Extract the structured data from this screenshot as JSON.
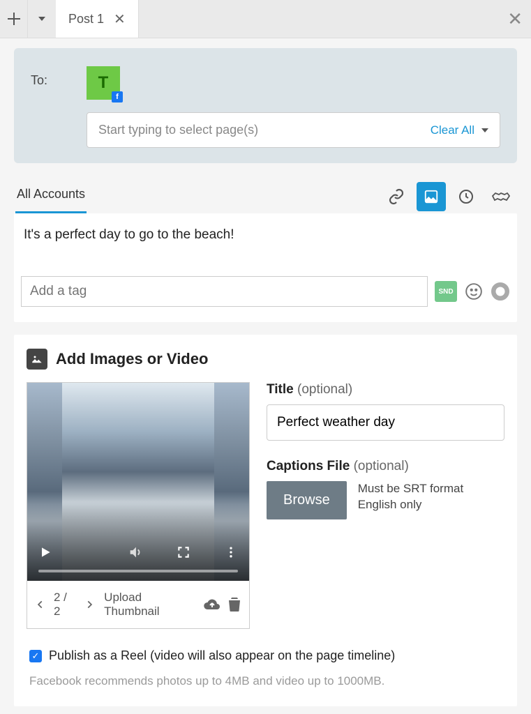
{
  "topbar": {
    "tab_label": "Post 1"
  },
  "to": {
    "label": "To:",
    "account_initial": "T",
    "select_placeholder": "Start typing to select page(s)",
    "clear_all_label": "Clear All"
  },
  "subtab": {
    "all_accounts": "All Accounts"
  },
  "post": {
    "text": "It's a perfect day to go to the beach!",
    "tag_placeholder": "Add a tag",
    "snd_label": "SND"
  },
  "media": {
    "heading": "Add Images or Video",
    "counter": "2 / 2",
    "upload_thumbnail": "Upload Thumbnail",
    "title_label": "Title",
    "optional": " (optional)",
    "title_value": "Perfect weather day",
    "captions_label": "Captions File",
    "browse_label": "Browse",
    "captions_hint_line1": "Must be SRT format",
    "captions_hint_line2": "English only"
  },
  "publish": {
    "label": "Publish as a Reel (video will also appear on the page timeline)",
    "checked": true
  },
  "hint": "Facebook recommends photos up to 4MB and video up to 1000MB."
}
